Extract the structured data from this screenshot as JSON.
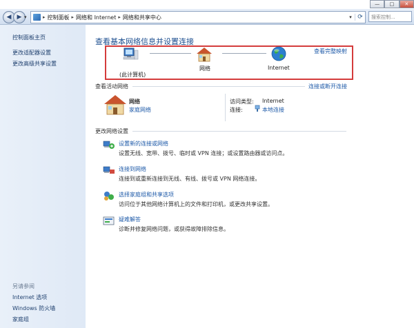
{
  "window": {
    "controls": {
      "minimize": "—",
      "maximize": "□",
      "close": "✕"
    }
  },
  "toolbar": {
    "back": "◀",
    "forward": "▶",
    "breadcrumbs": [
      "控制面板",
      "网络和 Internet",
      "网络和共享中心"
    ],
    "search_placeholder": "搜索控制..."
  },
  "sidebar": {
    "links": [
      "控制面板主页",
      "更改适配器设置",
      "更改高级共享设置"
    ],
    "see_also_heading": "另请参阅",
    "see_also": [
      "Internet 选项",
      "Windows 防火墙",
      "家庭组"
    ]
  },
  "main": {
    "title": "查看基本网络信息并设置连接",
    "full_map_link": "查看完整映射",
    "map": {
      "computer_label": "(此计算机)",
      "network_label": "网络",
      "internet_label": "Internet"
    },
    "active_networks_label": "查看活动网络",
    "connect_disconnect_link": "连接或断开连接",
    "network": {
      "name": "网络",
      "type": "家庭网络",
      "access_type_label": "访问类型:",
      "access_type_value": "Internet",
      "connections_label": "连接:",
      "connections_value": "本地连接"
    },
    "change_settings_label": "更改网络设置",
    "items": [
      {
        "title": "设置新的连接或网络",
        "desc": "设置无线、宽带、拨号、临时或 VPN 连接；或设置路由器或访问点。"
      },
      {
        "title": "连接到网络",
        "desc": "连接到或重新连接到无线、有线、拨号或 VPN 网络连接。"
      },
      {
        "title": "选择家庭组和共享选项",
        "desc": "访问位于其他网络计算机上的文件和打印机，或更改共享设置。"
      },
      {
        "title": "疑难解答",
        "desc": "诊断并修复网络问题，或获得故障排除信息。"
      }
    ]
  }
}
